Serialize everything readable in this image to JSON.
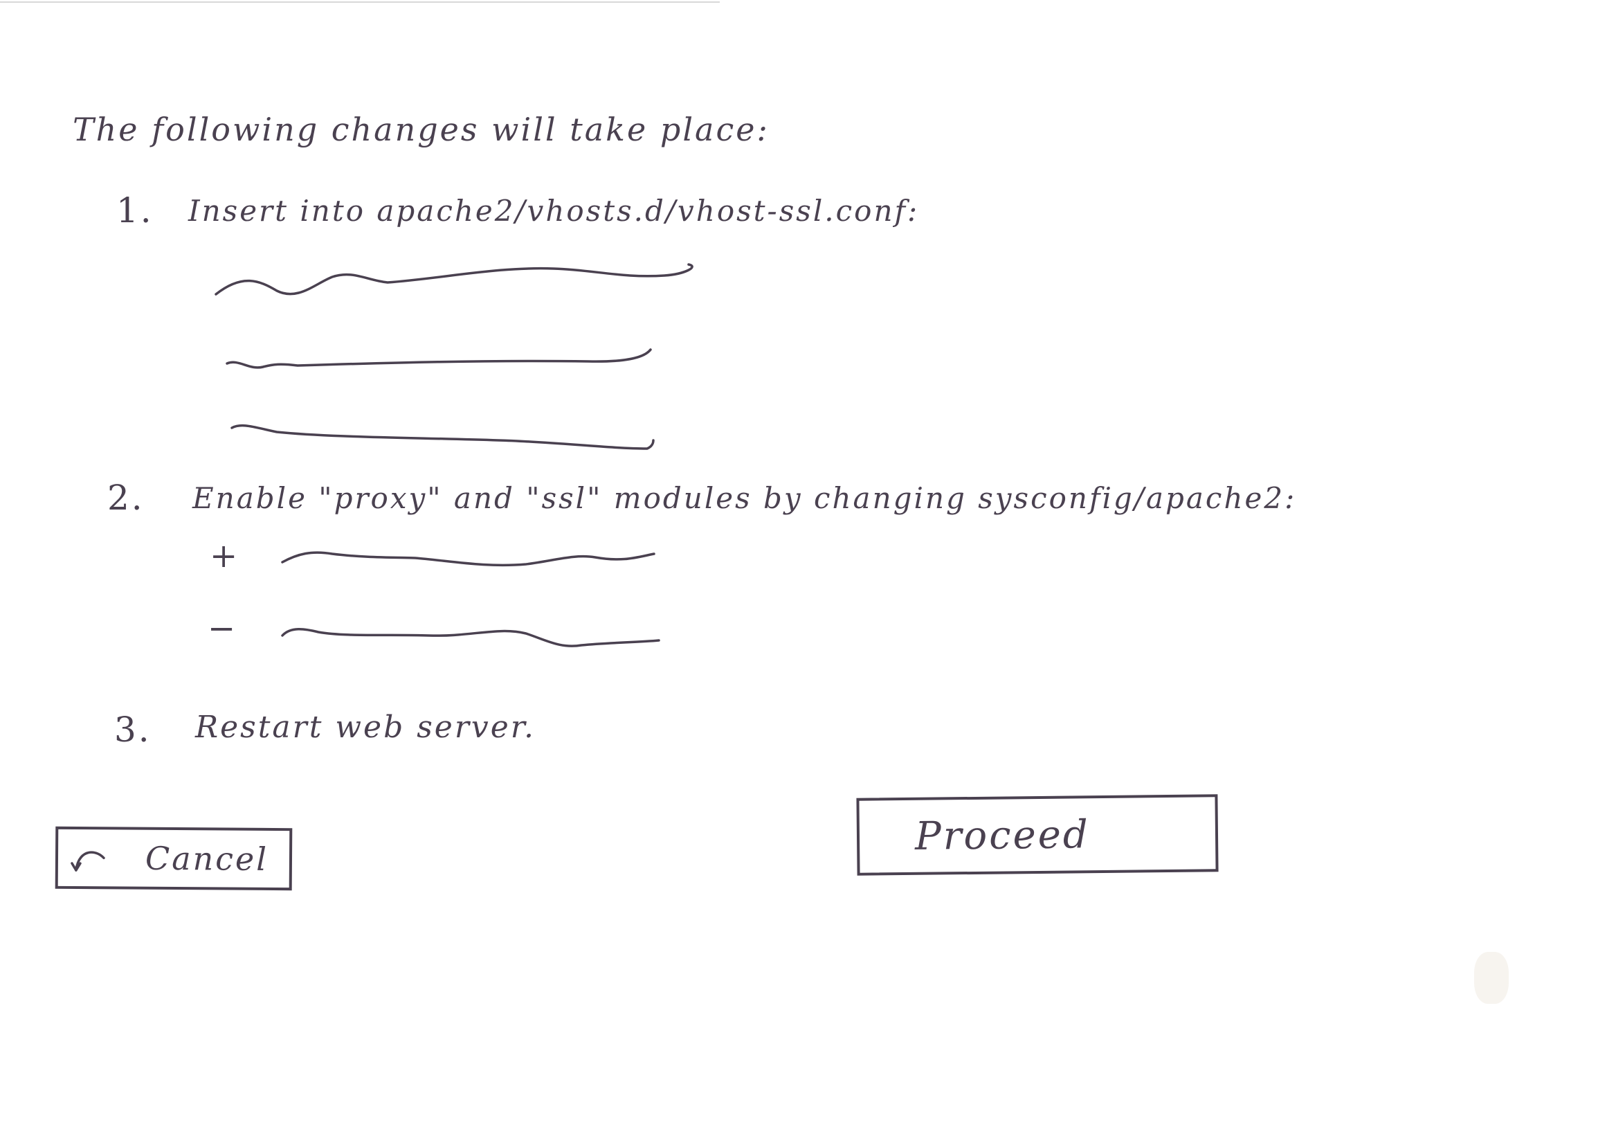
{
  "dialog": {
    "heading": "The following changes will take place:",
    "steps": [
      {
        "number": "1.",
        "text": "Insert into apache2/vhosts.d/vhost-ssl.conf:"
      },
      {
        "number": "2.",
        "text": "Enable \"proxy\" and \"ssl\" modules by changing sysconfig/apache2:",
        "diff_added_marker": "+",
        "diff_removed_marker": "−"
      },
      {
        "number": "3.",
        "text": "Restart web server."
      }
    ],
    "cancel_label": "Cancel",
    "cancel_icon": "undo-arrow-icon",
    "proceed_label": "Proceed"
  },
  "colors": {
    "ink": "#4a4150",
    "paper": "#ffffff"
  }
}
